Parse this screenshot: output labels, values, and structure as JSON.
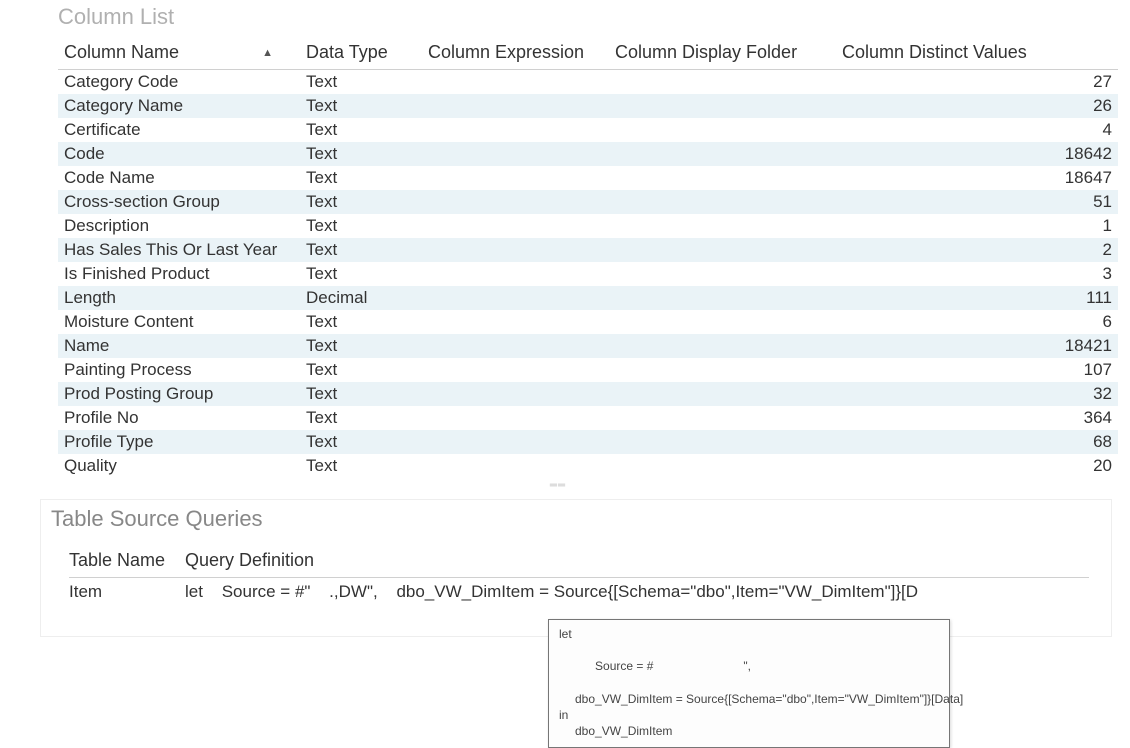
{
  "columnList": {
    "title": "Column List",
    "headers": {
      "name": "Column Name",
      "type": "Data Type",
      "expr": "Column Expression",
      "folder": "Column Display Folder",
      "distinct": "Column Distinct Values"
    },
    "sortAscGlyph": "▲",
    "rows": [
      {
        "name": "Category Code",
        "type": "Text",
        "distinct": "27"
      },
      {
        "name": "Category Name",
        "type": "Text",
        "distinct": "26"
      },
      {
        "name": "Certificate",
        "type": "Text",
        "distinct": "4"
      },
      {
        "name": "Code",
        "type": "Text",
        "distinct": "18642"
      },
      {
        "name": "Code Name",
        "type": "Text",
        "distinct": "18647"
      },
      {
        "name": "Cross-section Group",
        "type": "Text",
        "distinct": "51"
      },
      {
        "name": "Description",
        "type": "Text",
        "distinct": "1"
      },
      {
        "name": "Has Sales This Or Last Year",
        "type": "Text",
        "distinct": "2"
      },
      {
        "name": "Is Finished Product",
        "type": "Text",
        "distinct": "3"
      },
      {
        "name": "Length",
        "type": "Decimal",
        "distinct": "111"
      },
      {
        "name": "Moisture Content",
        "type": "Text",
        "distinct": "6"
      },
      {
        "name": "Name",
        "type": "Text",
        "distinct": "18421"
      },
      {
        "name": "Painting Process",
        "type": "Text",
        "distinct": "107"
      },
      {
        "name": "Prod Posting Group",
        "type": "Text",
        "distinct": "32"
      },
      {
        "name": "Profile No",
        "type": "Text",
        "distinct": "364"
      },
      {
        "name": "Profile Type",
        "type": "Text",
        "distinct": "68"
      },
      {
        "name": "Quality",
        "type": "Text",
        "distinct": "20"
      }
    ]
  },
  "queries": {
    "title": "Table Source Queries",
    "headers": {
      "name": "Table Name",
      "def": "Query Definition"
    },
    "row": {
      "name": "Item",
      "defParts": {
        "p1": "let",
        "p2": "Source = #\"",
        "p3": ".,DW\",",
        "p4": "dbo_VW_DimItem = Source{[Schema=\"dbo\",Item=\"VW_DimItem\"]}[D"
      }
    },
    "tooltip": {
      "l1": "let",
      "l2": "Source = #",
      "l2b": "\",",
      "l3": "dbo_VW_DimItem = Source{[Schema=\"dbo\",Item=\"VW_DimItem\"]}[Data]",
      "l4": "in",
      "l5": "dbo_VW_DimItem"
    }
  }
}
